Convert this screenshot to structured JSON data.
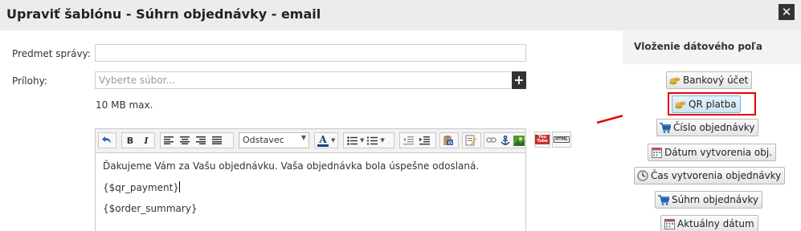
{
  "dialog": {
    "title": "Upraviť šablónu - Súhrn objednávky - email",
    "close_glyph": "✕"
  },
  "form": {
    "subject_label": "Predmet správy:",
    "subject_value": "",
    "attachments_label": "Prílohy:",
    "file_placeholder": "Vyberte súbor...",
    "add_file_glyph": "+",
    "max_note": "10 MB max."
  },
  "editor": {
    "format_select": "Odstavec",
    "toolbar_icons": [
      "undo-icon",
      "bold-icon",
      "italic-icon",
      "align-left-icon",
      "align-center-icon",
      "align-right-icon",
      "align-justify-icon",
      "font-color-icon",
      "bullet-list-icon",
      "numbered-list-icon",
      "outdent-icon",
      "indent-icon",
      "paste-word-icon",
      "edit-source-icon",
      "link-icon",
      "anchor-icon",
      "image-icon",
      "youtube-icon",
      "html-icon"
    ],
    "bold_glyph": "B",
    "italic_glyph": "I",
    "font_color_glyph": "A",
    "youtube_text": "You Tube",
    "html_text": "HTML",
    "lines": [
      "Ďakujeme Vám za Vašu objednávku. Vaša objednávka bola úspešne odoslaná.",
      "{$qr_payment}",
      "{$order_summary}"
    ]
  },
  "sidebar": {
    "title": "Vloženie dátového poľa",
    "buttons": [
      {
        "label": "Bankový účet",
        "icon": "coins-icon"
      },
      {
        "label": "QR platba",
        "icon": "coins-icon"
      },
      {
        "label": "Číslo objednávky",
        "icon": "cart-icon"
      },
      {
        "label": "Dátum vytvorenia obj.",
        "icon": "calendar-icon"
      },
      {
        "label": "Čas vytvorenia objednávky",
        "icon": "clock-icon"
      },
      {
        "label": "Súhrn objednávky",
        "icon": "cart-icon"
      },
      {
        "label": "Aktuálny dátum",
        "icon": "calendar-icon"
      }
    ]
  },
  "colors": {
    "highlight": "#e60000",
    "titlebar_bg": "#ececec"
  }
}
